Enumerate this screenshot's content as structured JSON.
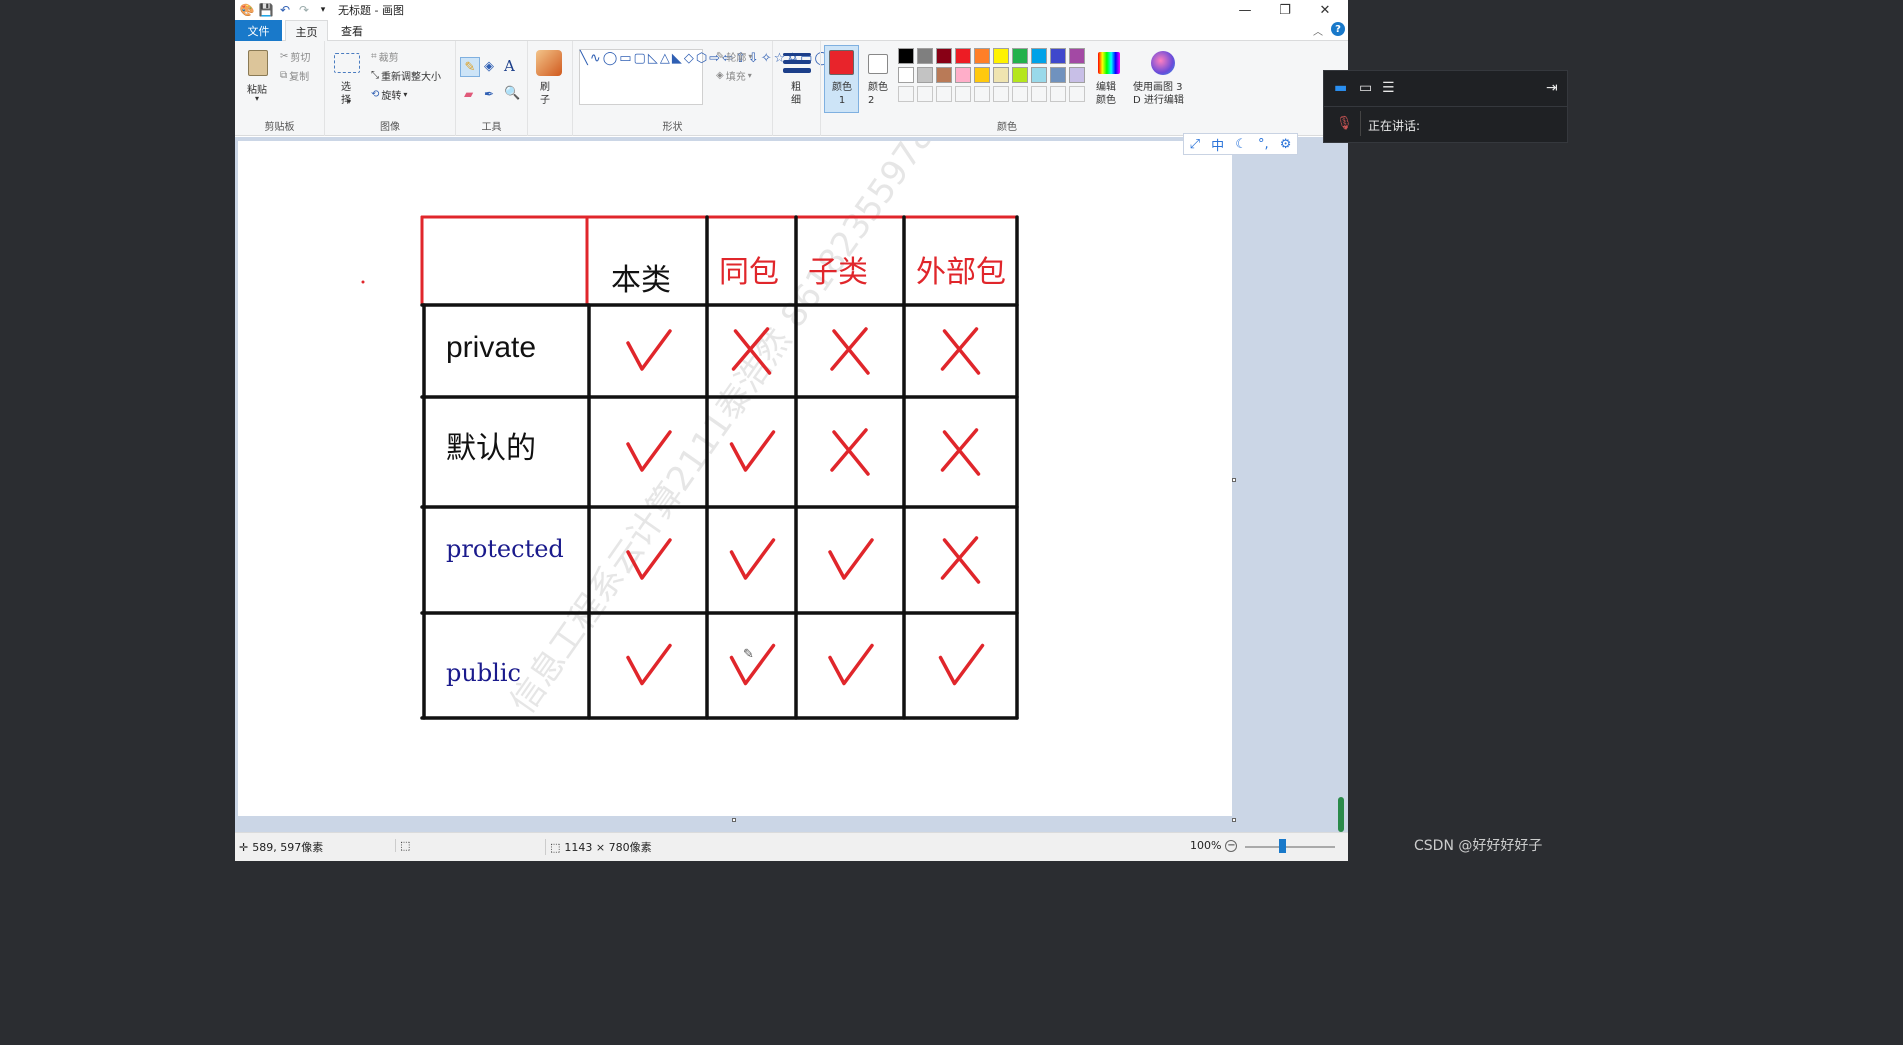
{
  "window": {
    "title": "无标题 - 画图",
    "controls": {
      "minimize": "—",
      "restore": "❐",
      "close": "✕"
    }
  },
  "ribbon_tabs": {
    "file": "文件",
    "home": "主页",
    "view": "查看"
  },
  "ribbon": {
    "clipboard": {
      "paste": "粘贴",
      "cut": "剪切",
      "copy": "复制",
      "label": "剪贴板"
    },
    "image": {
      "select": "选择",
      "crop": "裁剪",
      "resize": "重新调整大小",
      "rotate": "旋转",
      "label": "图像"
    },
    "tools": {
      "label": "工具",
      "text_tool": "A"
    },
    "brushes": {
      "label": "刷子"
    },
    "shapes": {
      "outline": "轮廓",
      "fill": "填充",
      "label": "形状"
    },
    "size": {
      "label": "粗细"
    },
    "colors": {
      "color1": "颜色 1",
      "color2": "颜色 2",
      "edit": "编辑颜色",
      "paint3d": "使用画图 3 D 进行编辑",
      "label": "颜色",
      "color1_value": "#e8242b",
      "palette_row1": [
        "#000000",
        "#7f7f7f",
        "#880015",
        "#ed1c24",
        "#ff7f27",
        "#fff200",
        "#22b14c",
        "#00a2e8",
        "#3f48cc",
        "#a349a4"
      ],
      "palette_row2": [
        "#ffffff",
        "#c3c3c3",
        "#b97a57",
        "#ffaec9",
        "#ffc90e",
        "#efe4b0",
        "#b5e61d",
        "#99d9ea",
        "#7092be",
        "#c8bfe7"
      ]
    }
  },
  "table": {
    "headers": [
      "本类",
      "同包",
      "子类",
      "外部包"
    ],
    "rows": [
      {
        "label": "private",
        "marks": [
          "check",
          "cross",
          "cross",
          "cross"
        ]
      },
      {
        "label": "默认的",
        "marks": [
          "check",
          "check",
          "cross",
          "cross"
        ]
      },
      {
        "label": "protected",
        "marks": [
          "check",
          "check",
          "check",
          "cross"
        ]
      },
      {
        "label": "public",
        "marks": [
          "check",
          "check",
          "check",
          "check"
        ]
      }
    ]
  },
  "status": {
    "cursor_pos": "589, 597像素",
    "canvas_size": "1143 × 780像素",
    "zoom": "100%"
  },
  "ime_bar": {
    "mode": "中"
  },
  "meeting": {
    "speaking": "正在讲话:"
  },
  "watermark": {
    "csdn": "CSDN @好好好好子"
  }
}
